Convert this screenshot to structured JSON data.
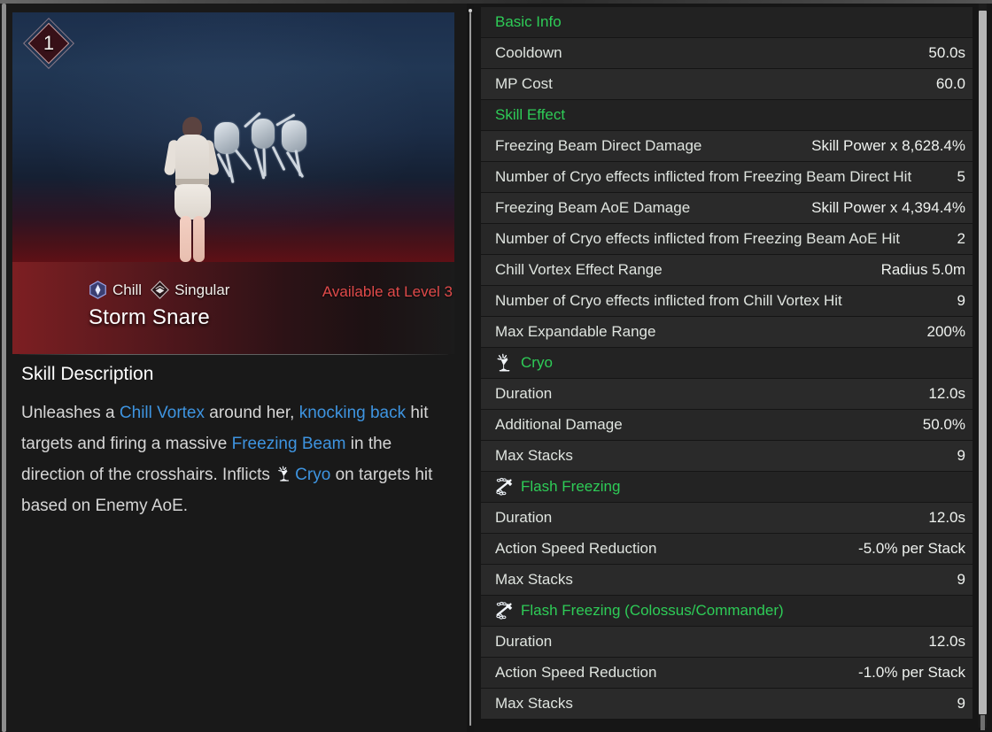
{
  "skill": {
    "level_badge": "1",
    "tags": [
      {
        "icon": "chill-element-icon",
        "label": "Chill"
      },
      {
        "icon": "singular-type-icon",
        "label": "Singular"
      }
    ],
    "name": "Storm Snare",
    "availability": "Available at Level 3",
    "description_heading": "Skill Description",
    "description_segments": [
      {
        "text": "Unleashes a ",
        "style": "plain"
      },
      {
        "text": "Chill Vortex",
        "style": "highlight"
      },
      {
        "text": " around her, ",
        "style": "plain"
      },
      {
        "text": "knocking back",
        "style": "highlight"
      },
      {
        "text": " hit targets and firing a massive ",
        "style": "plain"
      },
      {
        "text": "Freezing Beam",
        "style": "highlight"
      },
      {
        "text": " in the direction of the crosshairs. Inflicts ",
        "style": "plain"
      },
      {
        "text": "cryo-icon",
        "style": "icon"
      },
      {
        "text": "Cryo",
        "style": "highlight"
      },
      {
        "text": " on targets hit based on Enemy AoE.",
        "style": "plain"
      }
    ]
  },
  "colors": {
    "section_green": "#2ecc57",
    "highlight_blue": "#3e94e0",
    "availability_red": "#e04a4a",
    "value_text": "#eef1ee",
    "key_text": "#dfe4df"
  },
  "stats": [
    {
      "type": "section",
      "icon": null,
      "label": "Basic Info"
    },
    {
      "type": "stat",
      "key": "Cooldown",
      "value": "50.0s"
    },
    {
      "type": "stat",
      "key": "MP Cost",
      "value": "60.0"
    },
    {
      "type": "section",
      "icon": null,
      "label": "Skill Effect"
    },
    {
      "type": "stat",
      "key": "Freezing Beam Direct Damage",
      "value": "Skill Power x 8,628.4%"
    },
    {
      "type": "stat",
      "key": "Number of Cryo effects inflicted from Freezing Beam Direct Hit",
      "value": "5"
    },
    {
      "type": "stat",
      "key": "Freezing Beam AoE Damage",
      "value": "Skill Power x 4,394.4%"
    },
    {
      "type": "stat",
      "key": "Number of Cryo effects inflicted from Freezing Beam AoE Hit",
      "value": "2"
    },
    {
      "type": "stat",
      "key": "Chill Vortex Effect Range",
      "value": "Radius 5.0m"
    },
    {
      "type": "stat",
      "key": "Number of Cryo effects inflicted from Chill Vortex Hit",
      "value": "9"
    },
    {
      "type": "stat",
      "key": "Max Expandable Range",
      "value": "200%"
    },
    {
      "type": "section",
      "icon": "cryo-icon",
      "label": "Cryo"
    },
    {
      "type": "stat",
      "key": "Duration",
      "value": "12.0s"
    },
    {
      "type": "stat",
      "key": "Additional Damage",
      "value": "50.0%"
    },
    {
      "type": "stat",
      "key": "Max Stacks",
      "value": "9"
    },
    {
      "type": "section",
      "icon": "flash-freezing-icon",
      "label": "Flash Freezing"
    },
    {
      "type": "stat",
      "key": "Duration",
      "value": "12.0s"
    },
    {
      "type": "stat",
      "key": "Action Speed Reduction",
      "value": "-5.0% per Stack"
    },
    {
      "type": "stat",
      "key": "Max Stacks",
      "value": "9"
    },
    {
      "type": "section",
      "icon": "flash-freezing-icon",
      "label": "Flash Freezing (Colossus/Commander)"
    },
    {
      "type": "stat",
      "key": "Duration",
      "value": "12.0s"
    },
    {
      "type": "stat",
      "key": "Action Speed Reduction",
      "value": "-1.0% per Stack"
    },
    {
      "type": "stat",
      "key": "Max Stacks",
      "value": "9"
    }
  ]
}
